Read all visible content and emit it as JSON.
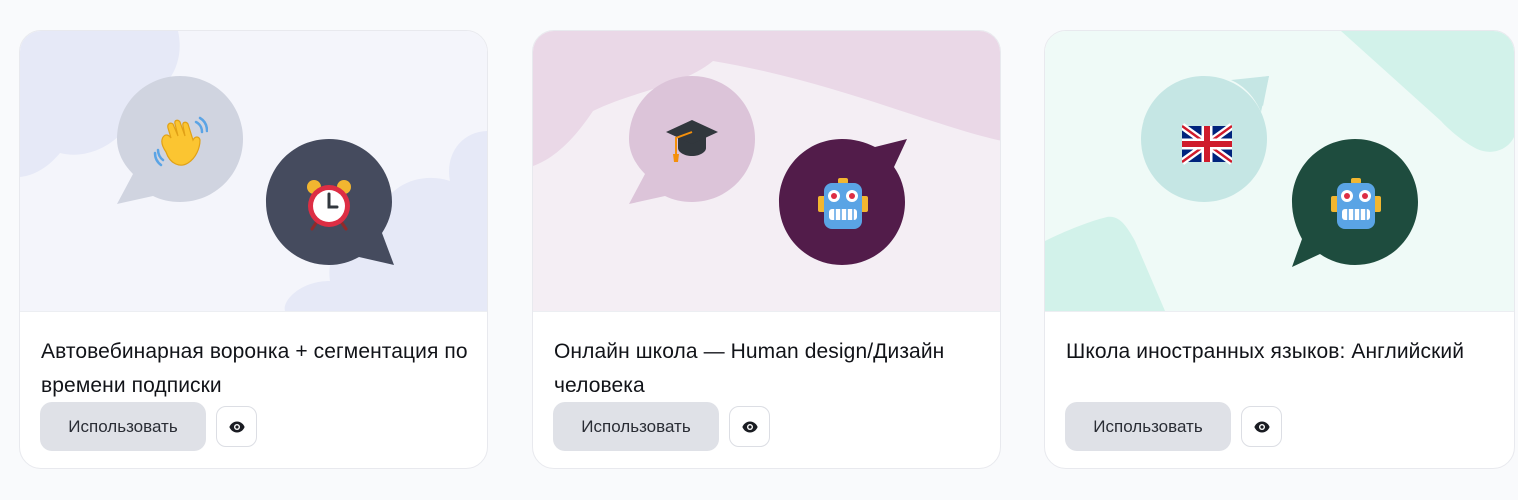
{
  "colors": {
    "page_bg": "#f9fafc",
    "button_bg": "#dfe1e7"
  },
  "cards": [
    {
      "title": "Автовебинарная воронка + сегментация по времени подписки",
      "use_label": "Использовать",
      "preview_icon": "eye-icon",
      "banner": {
        "theme": "lavender",
        "bg": "#f4f5fb",
        "blob": "#e6e9f7",
        "bubble_left_color": "#d0d4e0",
        "bubble_right_color": "#454b5e",
        "emoji_left": "waving-hand-icon",
        "emoji_right": "alarm-clock-icon"
      }
    },
    {
      "title": "Онлайн школа — Human design/Дизайн человека",
      "use_label": "Использовать",
      "preview_icon": "eye-icon",
      "banner": {
        "theme": "mauve",
        "bg": "#f4eef4",
        "blob": "#ead8e7",
        "bubble_left_color": "#dcc4d9",
        "bubble_right_color": "#521c4a",
        "emoji_left": "graduation-cap-icon",
        "emoji_right": "robot-icon"
      }
    },
    {
      "title": "Школа иностранных языков: Английский",
      "use_label": "Использовать",
      "preview_icon": "eye-icon",
      "banner": {
        "theme": "mint",
        "bg": "#effaf7",
        "blob": "#d2f2ea",
        "bubble_left_color": "#c5e6e4",
        "bubble_right_color": "#1e4c3e",
        "emoji_left": "uk-flag-icon",
        "emoji_right": "robot-icon"
      }
    }
  ]
}
